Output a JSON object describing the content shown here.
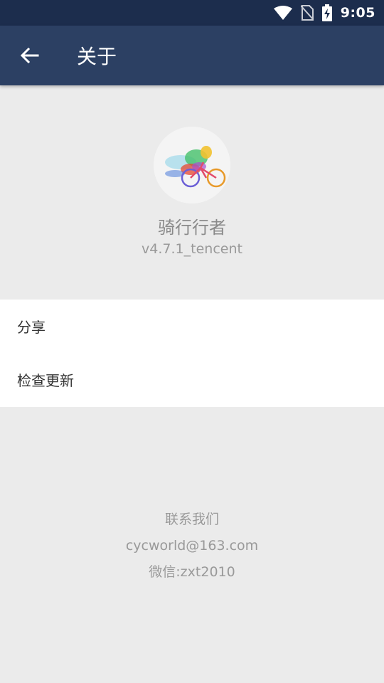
{
  "status_bar": {
    "time": "9:05",
    "icons": [
      "wifi-icon",
      "no-sim-icon",
      "battery-charging-icon"
    ]
  },
  "app_bar": {
    "back_icon": "arrow-left-icon",
    "title": "关于"
  },
  "app_info": {
    "name": "骑行行者",
    "version": "v4.7.1_tencent",
    "logo_icon": "cyclist-logo-icon"
  },
  "menu": {
    "items": [
      {
        "label": "分享"
      },
      {
        "label": "检查更新"
      }
    ]
  },
  "contact": {
    "title": "联系我们",
    "email": "cycworld@163.com",
    "wechat": "微信:zxt2010"
  },
  "colors": {
    "status_bar": "#1c2d4d",
    "app_bar": "#2c4063",
    "background": "#ebebeb"
  }
}
